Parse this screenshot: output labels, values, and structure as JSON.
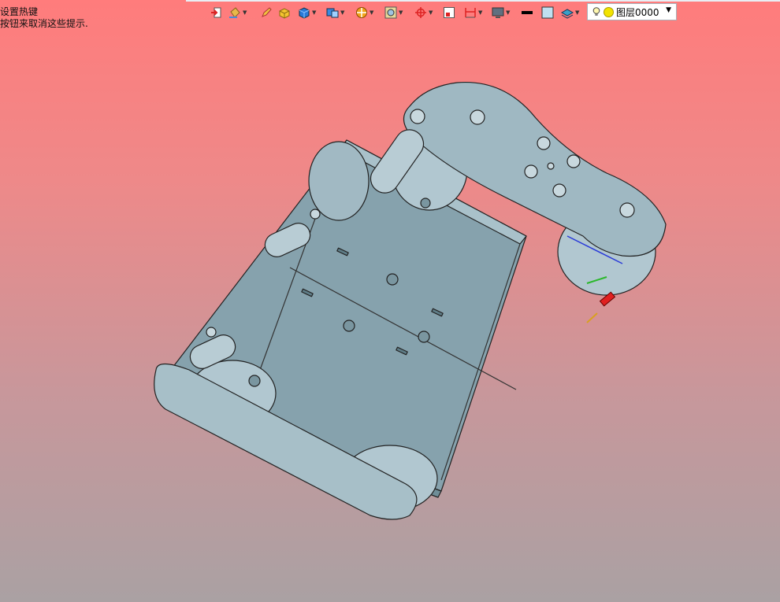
{
  "hint": {
    "line1": "设置热键",
    "line2": "按钮来取消这些提示."
  },
  "toolbar": {
    "tools": [
      {
        "icon": "exit-icon"
      },
      {
        "icon": "paint-bucket-icon",
        "dropdown": true
      },
      {
        "icon": "pencil-icon"
      },
      {
        "icon": "box-shaded-icon"
      },
      {
        "icon": "cube-icon",
        "dropdown": true
      },
      {
        "icon": "cube-views-icon",
        "dropdown": true
      },
      {
        "icon": "section-icon",
        "dropdown": true
      },
      {
        "icon": "render-icon",
        "dropdown": true
      },
      {
        "icon": "axis-icon",
        "dropdown": true
      },
      {
        "icon": "frame-icon"
      },
      {
        "icon": "dimension-icon",
        "dropdown": true
      },
      {
        "icon": "monitor-icon",
        "dropdown": true
      },
      {
        "icon": "line-color-icon"
      },
      {
        "icon": "fill-color-icon"
      },
      {
        "icon": "layers-icon",
        "dropdown": true
      }
    ],
    "layer": {
      "name": "图层0000"
    }
  },
  "colors": {
    "accent_red": "#e02020",
    "model_fill": "#97b1bb",
    "model_shadow": "#7f9aa4",
    "background_top": "#ff7c7c",
    "background_bottom": "#aaa1a3"
  }
}
